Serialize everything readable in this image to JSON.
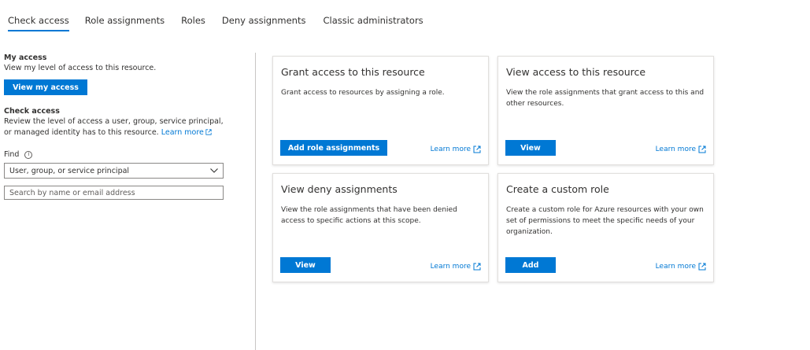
{
  "tabs": [
    {
      "label": "Check access",
      "active": true
    },
    {
      "label": "Role assignments",
      "active": false
    },
    {
      "label": "Roles",
      "active": false
    },
    {
      "label": "Deny assignments",
      "active": false
    },
    {
      "label": "Classic administrators",
      "active": false
    }
  ],
  "my_access": {
    "title": "My access",
    "description": "View my level of access to this resource.",
    "button": "View my access"
  },
  "check_access": {
    "title": "Check access",
    "description": "Review the level of access a user, group, service principal, or managed identity has to this resource.",
    "learn_more": "Learn more",
    "find_label": "Find",
    "info_glyph": "i",
    "dropdown_value": "User, group, or service principal",
    "search_placeholder": "Search by name or email address"
  },
  "cards": [
    {
      "title": "Grant access to this resource",
      "description": "Grant access to resources by assigning a role.",
      "button": "Add role assignments",
      "learn_more": "Learn more"
    },
    {
      "title": "View access to this resource",
      "description": "View the role assignments that grant access to this and other resources.",
      "button": "View",
      "learn_more": "Learn more"
    },
    {
      "title": "View deny assignments",
      "description": "View the role assignments that have been denied access to specific actions at this scope.",
      "button": "View",
      "learn_more": "Learn more"
    },
    {
      "title": "Create a custom role",
      "description": "Create a custom role for Azure resources with your own set of permissions to meet the specific needs of your organization.",
      "button": "Add",
      "learn_more": "Learn more"
    }
  ],
  "colors": {
    "accent": "#0078d4",
    "text": "#323130",
    "border": "#e1dfdd"
  },
  "icons": {
    "info": "info-icon",
    "dropdown": "chevron-down-icon",
    "external": "external-link-icon"
  }
}
